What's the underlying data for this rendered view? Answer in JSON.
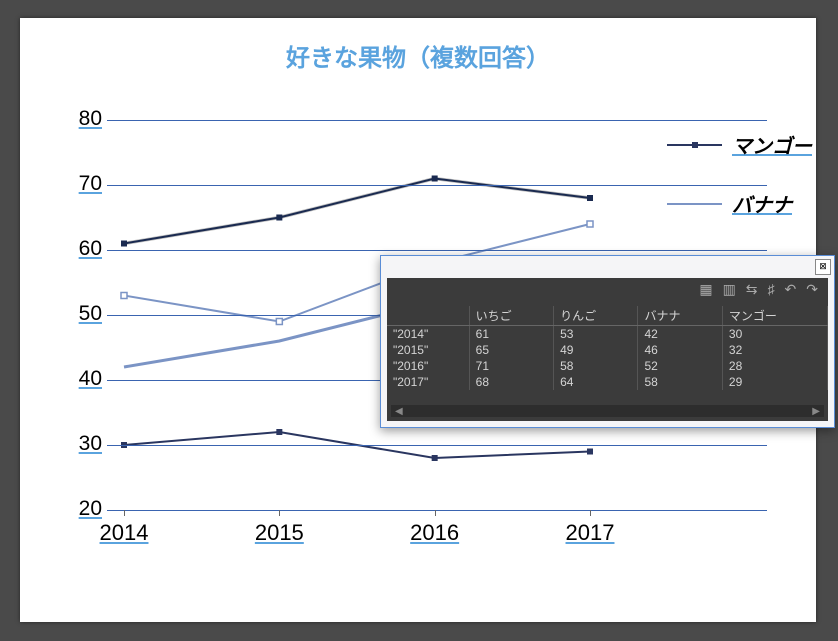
{
  "chart_data": {
    "type": "line",
    "title": "好きな果物（複数回答）",
    "categories": [
      "2014",
      "2015",
      "2016",
      "2017"
    ],
    "series": [
      {
        "name": "いちご",
        "values": [
          61,
          65,
          71,
          68
        ]
      },
      {
        "name": "りんご",
        "values": [
          53,
          49,
          58,
          64
        ]
      },
      {
        "name": "バナナ",
        "values": [
          42,
          46,
          52,
          58
        ]
      },
      {
        "name": "マンゴー",
        "values": [
          30,
          32,
          28,
          29
        ]
      }
    ],
    "ylim": [
      20,
      80
    ],
    "yticks": [
      20,
      30,
      40,
      50,
      60,
      70,
      80
    ],
    "legend_visible": [
      "マンゴー",
      "バナナ"
    ],
    "colors": {
      "いちご": {
        "stroke": "#1a2a50",
        "style": "solid",
        "marker": "square"
      },
      "マンゴー": {
        "stroke": "#2a3660",
        "style": "solid",
        "marker": "square"
      },
      "りんご": {
        "stroke": "#7b94c5",
        "style": "solid",
        "marker": "open-square"
      },
      "バナナ": {
        "stroke": "#7b94c5",
        "style": "solid",
        "marker": "none"
      }
    }
  },
  "popup": {
    "toolbar_icons": [
      "table-icon",
      "column-icon",
      "swap-icon",
      "grid-icon",
      "undo-icon",
      "redo-icon"
    ],
    "headers": [
      "",
      "いちご",
      "りんご",
      "バナナ",
      "マンゴー"
    ],
    "rows": [
      [
        "\"2014\"",
        "61",
        "53",
        "42",
        "30"
      ],
      [
        "\"2015\"",
        "65",
        "49",
        "46",
        "32"
      ],
      [
        "\"2016\"",
        "71",
        "58",
        "52",
        "28"
      ],
      [
        "\"2017\"",
        "68",
        "64",
        "58",
        "29"
      ]
    ],
    "close_glyph": "⊠"
  }
}
